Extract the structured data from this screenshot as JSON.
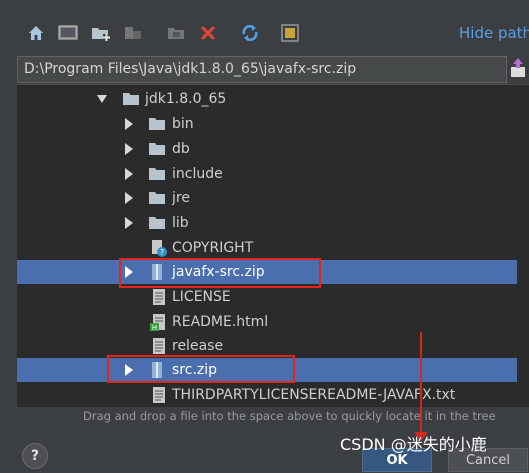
{
  "toolbar": {
    "buttons": [
      "home-icon",
      "desktop-icon",
      "new-folder-icon",
      "new-module-icon",
      "collapse-icon",
      "delete-icon",
      "refresh-icon",
      "show-hidden-icon"
    ],
    "hide_path_label": "Hide path"
  },
  "path": {
    "value": "D:\\Program Files\\Java\\jdk1.8.0_65\\javafx-src.zip"
  },
  "tree": {
    "items": [
      {
        "label": "jdk1.8.0_65",
        "expanded": true,
        "icon": "folder-icon"
      },
      {
        "label": "bin",
        "icon": "folder-icon"
      },
      {
        "label": "db",
        "icon": "folder-icon"
      },
      {
        "label": "include",
        "icon": "folder-icon"
      },
      {
        "label": "jre",
        "icon": "folder-icon"
      },
      {
        "label": "lib",
        "icon": "folder-icon"
      },
      {
        "label": "COPYRIGHT",
        "icon": "unknown-file-icon"
      },
      {
        "label": "javafx-src.zip",
        "icon": "archive-icon",
        "selected": true,
        "highlighted": true
      },
      {
        "label": "LICENSE",
        "icon": "text-file-icon"
      },
      {
        "label": "README.html",
        "icon": "html-file-icon"
      },
      {
        "label": "release",
        "icon": "text-file-icon"
      },
      {
        "label": "src.zip",
        "icon": "archive-icon",
        "selected": true,
        "highlighted": true
      },
      {
        "label": "THIRDPARTYLICENSEREADME-JAVAFX.txt",
        "icon": "text-file-icon"
      }
    ]
  },
  "hint": "Drag and drop a file into the space above to quickly locate it in the tree",
  "footer": {
    "help_label": "?",
    "ok_label": "OK",
    "cancel_label": "Cancel"
  },
  "watermark": "CSDN @迷失的小鹿",
  "colors": {
    "selection": "#4b6eaf",
    "highlight_box": "#e0251d",
    "link": "#5a9fe6"
  }
}
